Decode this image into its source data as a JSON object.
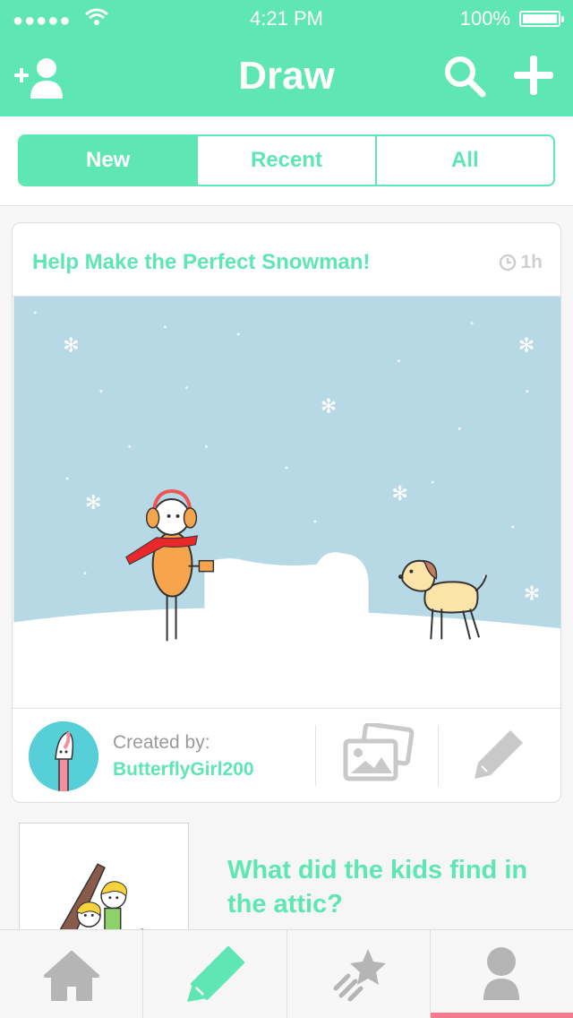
{
  "status": {
    "time": "4:21 PM",
    "battery": "100%"
  },
  "header": {
    "title": "Draw"
  },
  "segments": [
    "New",
    "Recent",
    "All"
  ],
  "card": {
    "title": "Help Make the Perfect Snowman!",
    "time": "1h",
    "created_label": "Created by:",
    "creator": "ButterflyGirl200"
  },
  "next_item": {
    "title": "What did the kids find in the attic?"
  },
  "colors": {
    "accent": "#5ee6b4",
    "sky": "#b7d9e6",
    "active_indicator": "#f47b8e"
  },
  "icons": {
    "add_friend": "add-friend-icon",
    "search": "search-icon",
    "plus": "plus-icon",
    "clock": "clock-icon",
    "gallery": "gallery-icon",
    "pencil": "pencil-icon",
    "home": "home-icon",
    "draw": "draw-pencil-icon",
    "explore": "shooting-star-icon",
    "profile": "profile-icon"
  }
}
